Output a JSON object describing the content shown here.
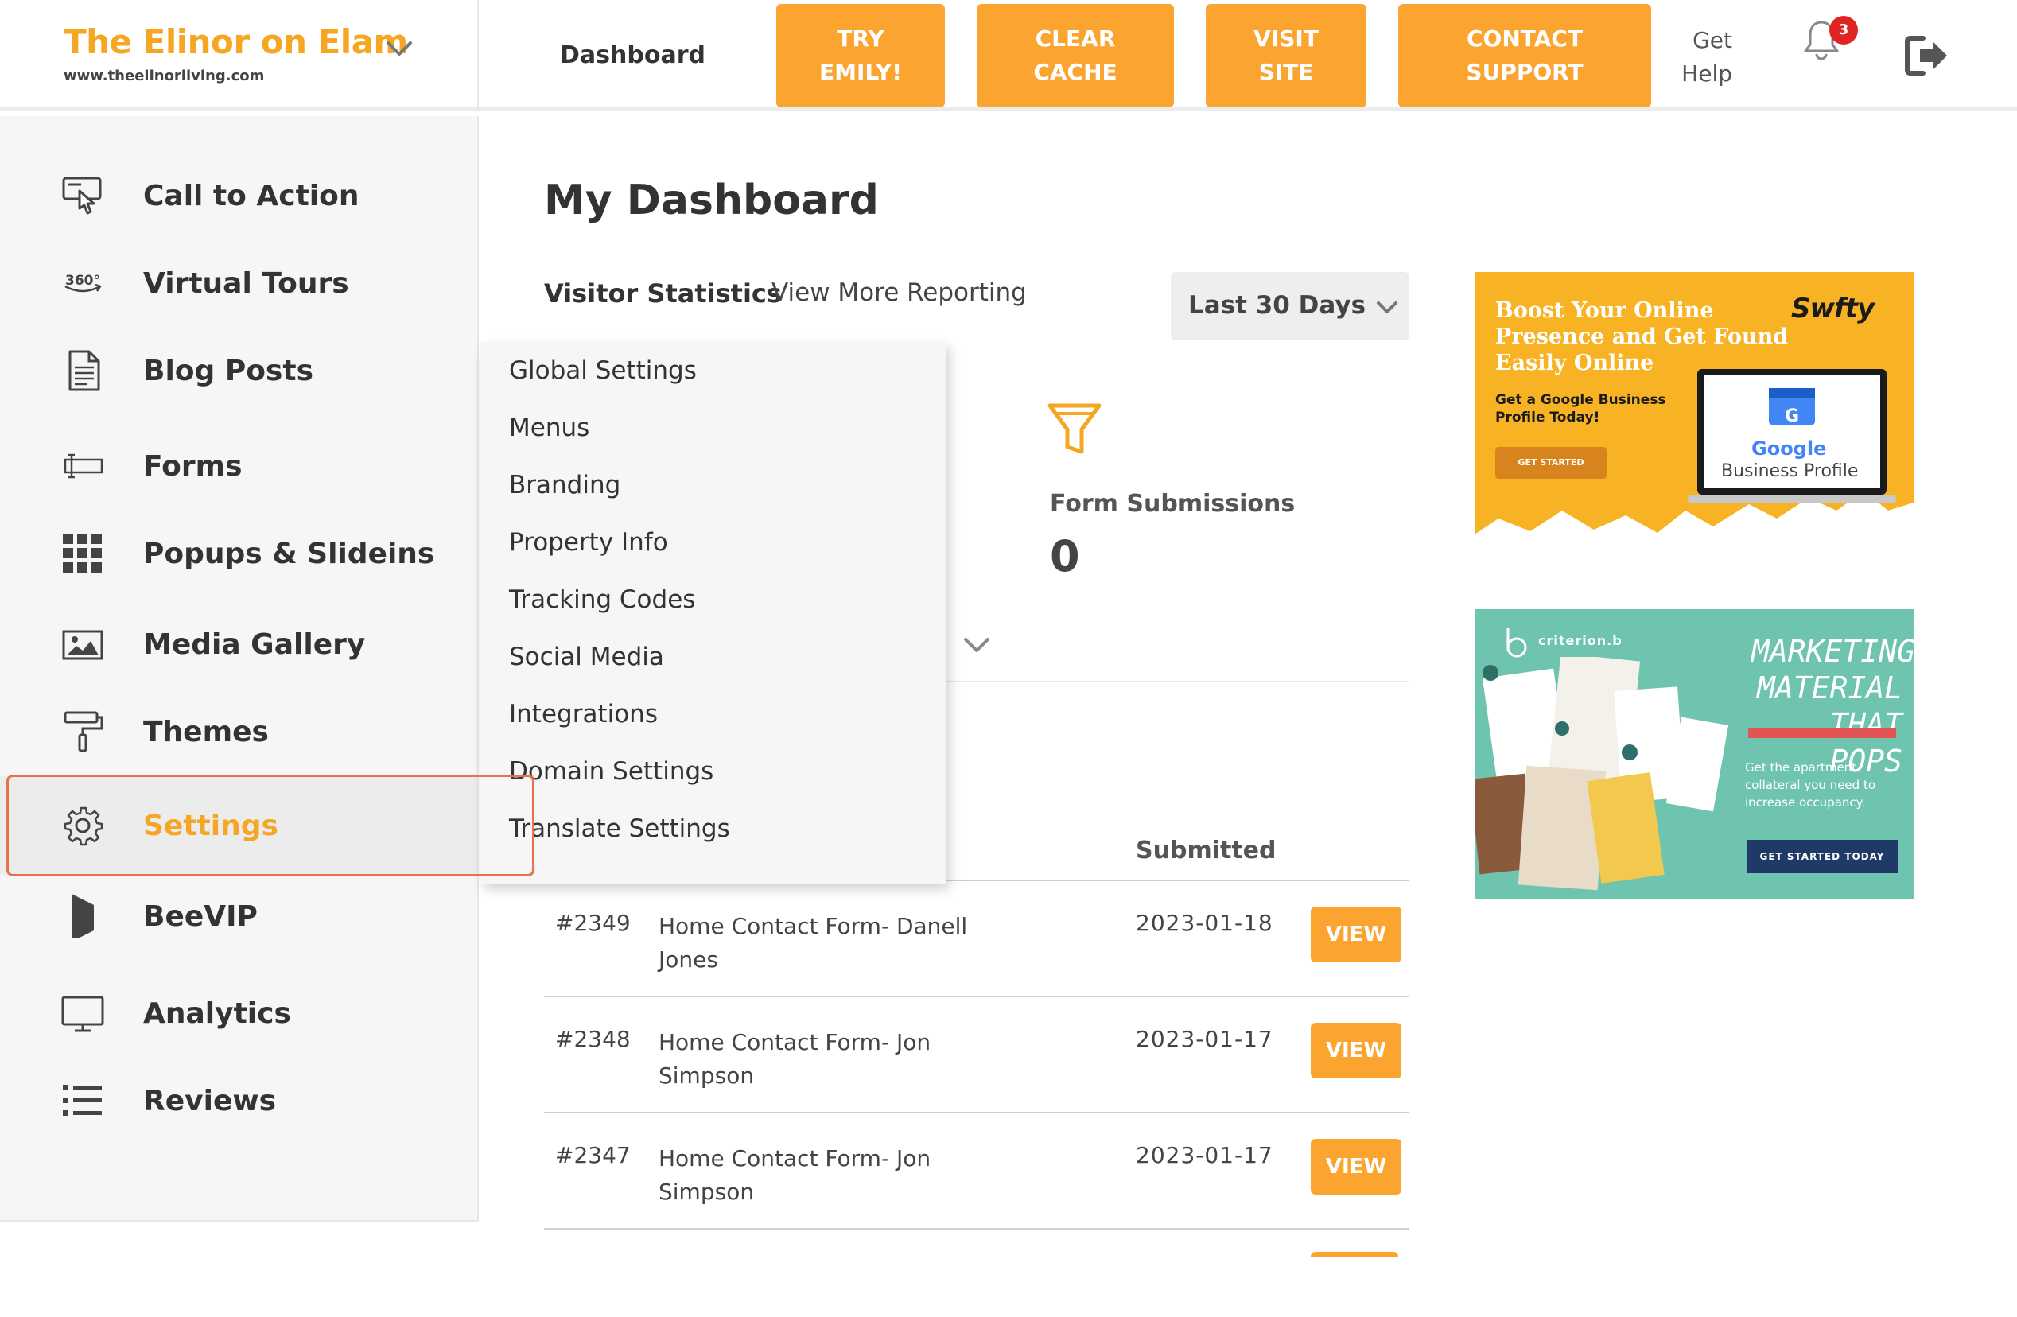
{
  "header": {
    "brand_name": "The Elinor on Elam",
    "brand_url": "www.theelinorliving.com",
    "nav_dashboard": "Dashboard",
    "buttons": {
      "try_emily": [
        "TRY",
        "EMILY!"
      ],
      "clear_cache": [
        "CLEAR",
        "CACHE"
      ],
      "visit_site": [
        "VISIT",
        "SITE"
      ],
      "contact_support": [
        "CONTACT",
        "SUPPORT"
      ]
    },
    "get_help": "Get Help",
    "notification_count": "3",
    "icons": {
      "brand_toggle": "chevron-down-icon",
      "notifications": "bell-icon",
      "logout": "logout-icon"
    }
  },
  "sidebar": {
    "items": [
      {
        "label": "Call to Action",
        "icon": "pointer-click-icon"
      },
      {
        "label": "Virtual Tours",
        "icon": "360-icon"
      },
      {
        "label": "Blog Posts",
        "icon": "document-icon"
      },
      {
        "label": "Forms",
        "icon": "text-field-icon"
      },
      {
        "label": "Popups & Slideins",
        "icon": "grid-icon"
      },
      {
        "label": "Media Gallery",
        "icon": "image-icon"
      },
      {
        "label": "Themes",
        "icon": "paint-roller-icon"
      },
      {
        "label": "Settings",
        "icon": "gear-icon"
      },
      {
        "label": "BeeVIP",
        "icon": "flag-icon"
      },
      {
        "label": "Analytics",
        "icon": "monitor-icon"
      },
      {
        "label": "Reviews",
        "icon": "list-icon"
      }
    ],
    "active": "Settings"
  },
  "settings_menu": {
    "items": [
      "Global Settings",
      "Menus",
      "Branding",
      "Property Info",
      "Tracking Codes",
      "Social Media",
      "Integrations",
      "Domain Settings",
      "Translate Settings"
    ]
  },
  "main": {
    "title": "My Dashboard",
    "visitor_statistics": "Visitor Statistics",
    "view_more_reporting": "View More Reporting",
    "date_range": "Last 30 Days",
    "form_submissions_label": "Form Submissions",
    "form_submissions_value": "0",
    "table": {
      "submitted_header": "Submitted",
      "view_label": "VIEW",
      "rows": [
        {
          "id": "#2349",
          "name": "Home Contact Form- Danell Jones",
          "date": "2023-01-18"
        },
        {
          "id": "#2348",
          "name": "Home Contact Form- Jon Simpson",
          "date": "2023-01-17"
        },
        {
          "id": "#2347",
          "name": "Home Contact Form- Jon Simpson",
          "date": "2023-01-17"
        }
      ]
    }
  },
  "ads": {
    "swifty": {
      "headline": "Boost Your Online Presence and Get Found Easily Online",
      "brand": "Swfty",
      "subtext": "Get a Google Business Profile Today!",
      "cta": "GET STARTED",
      "product_brand": "Google",
      "product_name": "Business Profile"
    },
    "criterion": {
      "logo": "criterion.b",
      "headline": [
        "MARKETING",
        "MATERIAL",
        "THAT POPS"
      ],
      "subtext": "Get the apartment collateral you need to increase occupancy.",
      "cta": "GET STARTED TODAY"
    }
  },
  "colors": {
    "accent": "#fba530",
    "brand_text": "#f5a623",
    "highlight_outline": "#e8734a",
    "badge": "#e02424",
    "ad1_bg": "#f7b324",
    "ad2_bg": "#6fc4b0"
  }
}
